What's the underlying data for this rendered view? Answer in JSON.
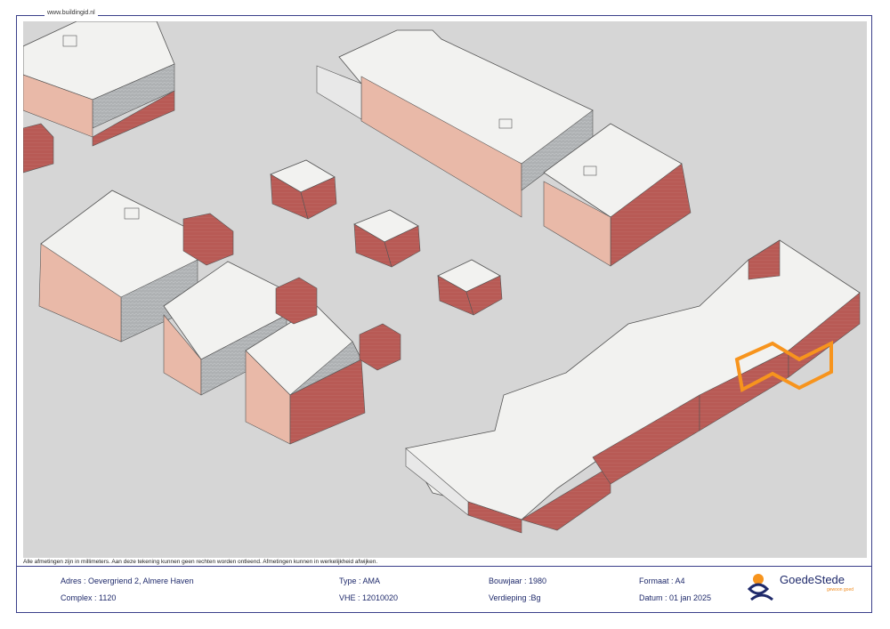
{
  "header": {
    "url": "www.buildingid.nl"
  },
  "disclaimer": "Alle afmetingen zijn in millimeters. Aan deze tekening kunnen geen rechten worden ontleend. Afmetingen kunnen in werkelijkheid afwijken.",
  "titleblock": {
    "adres": "Adres :  Oevergriend 2, Almere Haven",
    "complex": "Complex : 1120",
    "type": "Type : AMA",
    "vhe": "VHE :  12010020",
    "bouwjaar": "Bouwjaar : 1980",
    "verdieping": "Verdieping :Bg",
    "formaat": "Formaat : A4",
    "datum": "Datum :  01 jan 2025"
  },
  "logo": {
    "name": "GoedeStede",
    "tagline": "gewoon goed"
  },
  "colors": {
    "highlight": "#f7941d",
    "brick": "#b85a55",
    "roof": "#f2f2f0",
    "ground": "#d6d6d6",
    "frame": "#3a3f8a"
  }
}
